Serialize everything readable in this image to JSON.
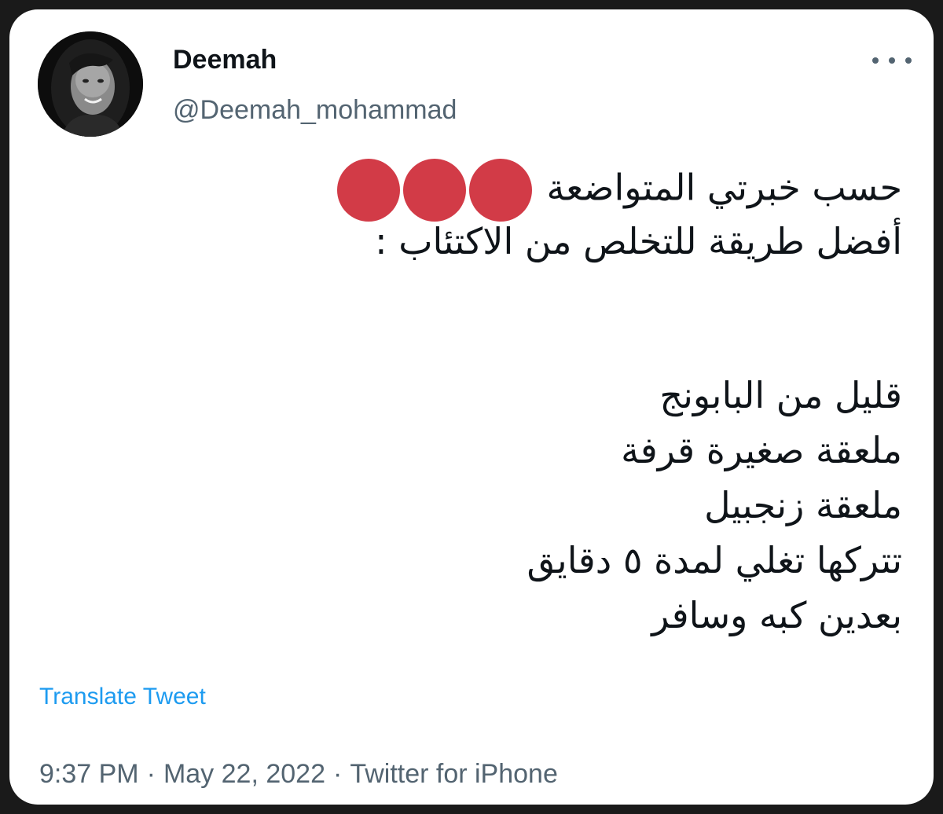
{
  "user": {
    "display_name": "Deemah",
    "handle": "@Deemah_mohammad"
  },
  "tweet": {
    "lines": [
      "حسب خبرتي المتواضعة",
      "أفضل طريقة للتخلص من الاكتئاب :",
      "قليل من البابونج",
      "ملعقة صغيرة قرفة",
      "ملعقة زنجبيل",
      "تتركها تغلي لمدة ٥ دقايق",
      "بعدين كبه وسافر"
    ],
    "emoji": "red-circle x3"
  },
  "actions": {
    "translate_label": "Translate Tweet"
  },
  "meta": {
    "time": "9:37 PM",
    "date": "May 22, 2022",
    "source": "Twitter for iPhone",
    "separator": "·"
  },
  "colors": {
    "accent": "#1d9bf0",
    "red_dot": "#d23b47",
    "secondary_text": "#536471",
    "primary_text": "#0f1419"
  },
  "icons": {
    "more": "more-horizontal-icon",
    "emoji_dot": "red-circle-icon"
  }
}
